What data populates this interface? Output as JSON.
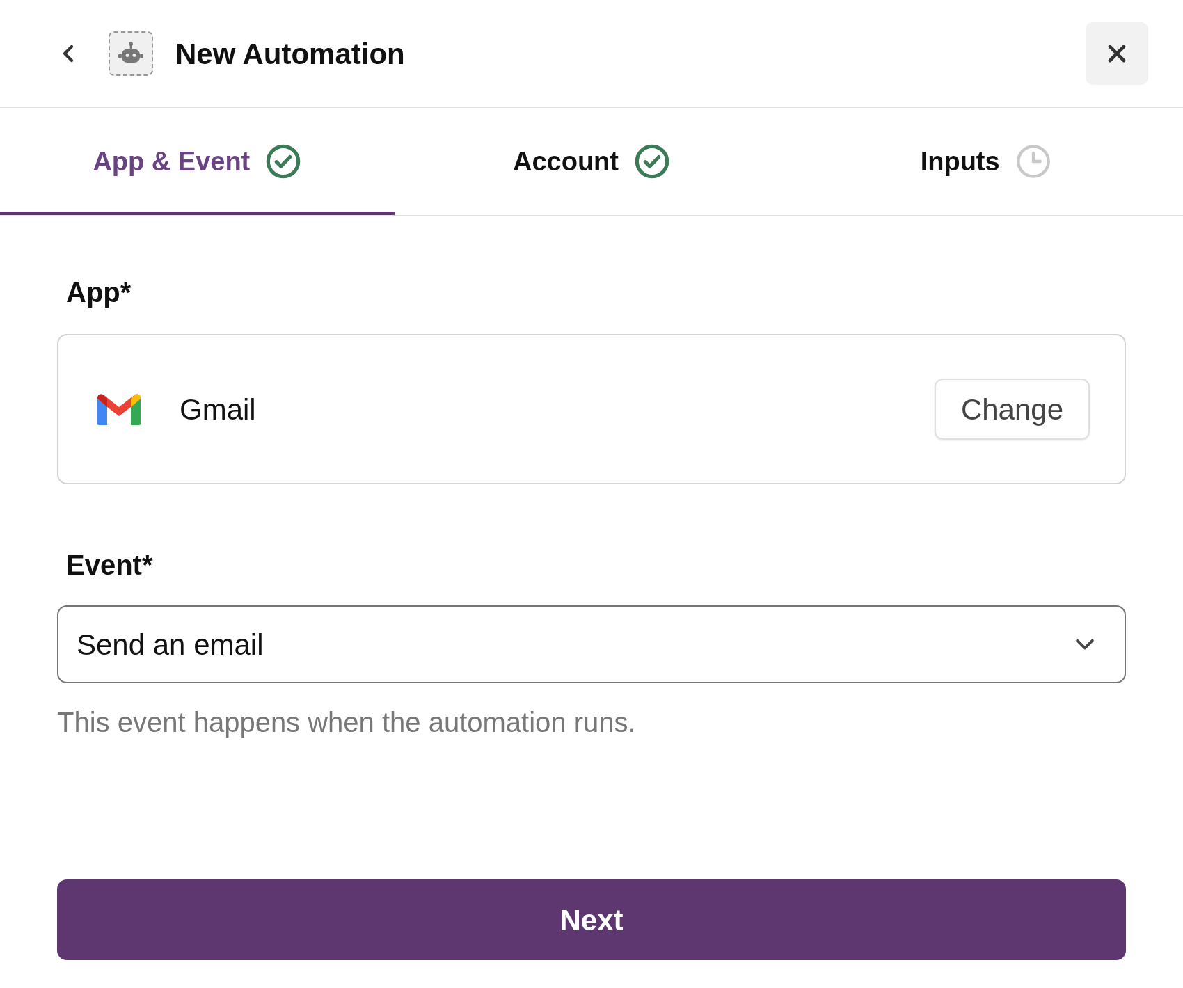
{
  "header": {
    "title": "New Automation"
  },
  "tabs": [
    {
      "label": "App & Event",
      "selected": true,
      "kind": "done"
    },
    {
      "label": "Account",
      "selected": false,
      "kind": "done"
    },
    {
      "label": "Inputs",
      "selected": false,
      "kind": "pending"
    }
  ],
  "app_field": {
    "label": "App*",
    "app": "Gmail",
    "button": "Change"
  },
  "event_field": {
    "label": "Event*",
    "value": "Send an email",
    "help": "This event happens when the automation runs."
  },
  "next_button": "Next"
}
